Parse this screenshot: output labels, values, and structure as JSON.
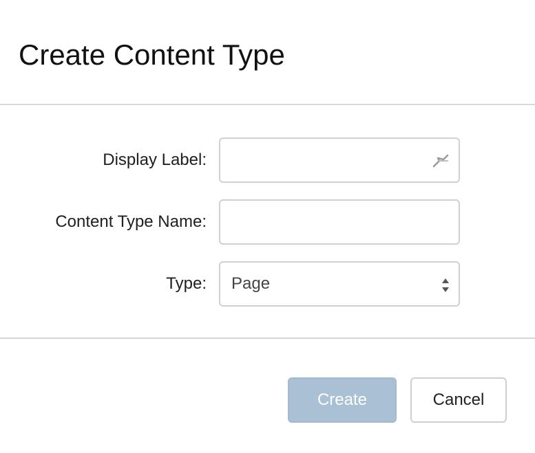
{
  "dialog": {
    "title": "Create Content Type"
  },
  "form": {
    "display_label": {
      "label": "Display Label:",
      "value": "",
      "icon": "key-icon"
    },
    "content_type_name": {
      "label": "Content Type Name:",
      "value": ""
    },
    "type": {
      "label": "Type:",
      "selected": "Page"
    }
  },
  "footer": {
    "create_label": "Create",
    "cancel_label": "Cancel"
  },
  "colors": {
    "create_bg": "#aac0d5",
    "border": "#d0d0d0",
    "divider": "#d8d8d8"
  }
}
